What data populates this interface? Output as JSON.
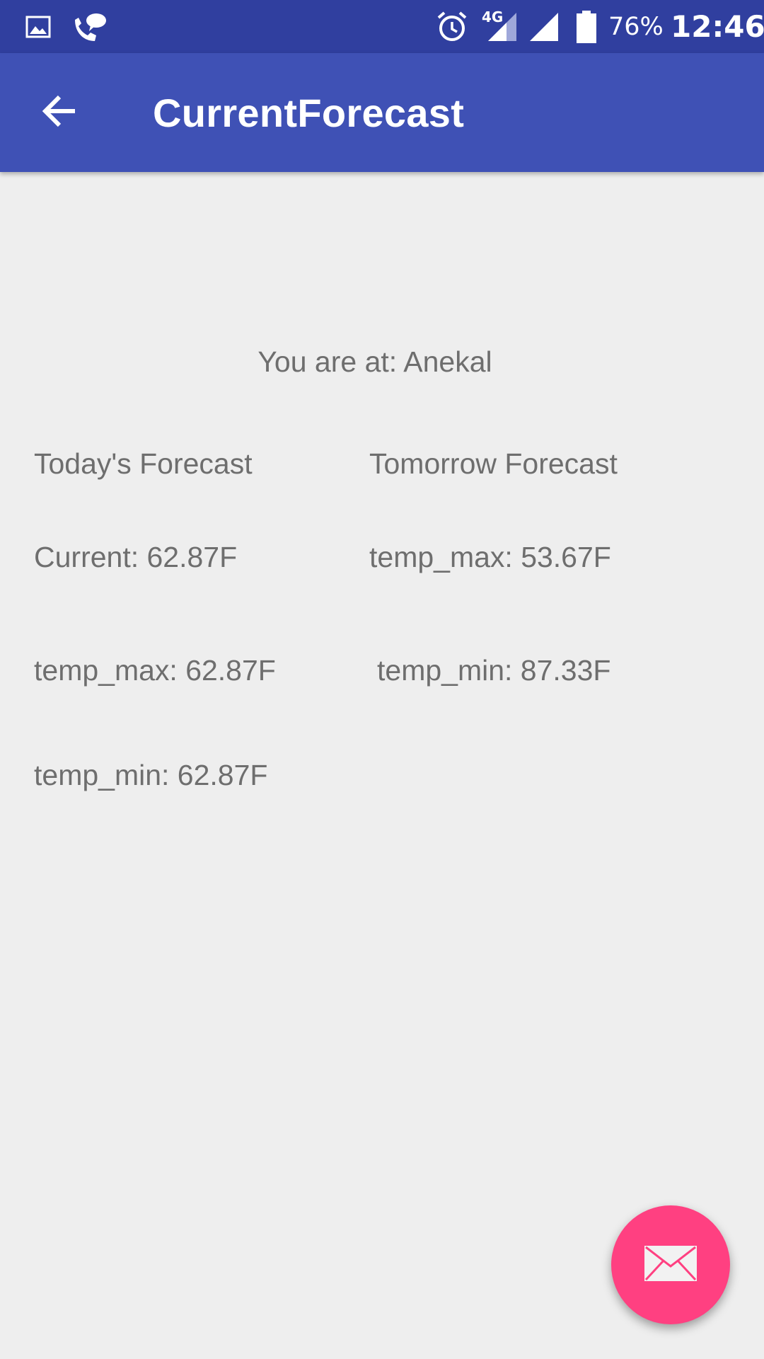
{
  "status_bar": {
    "battery": "76%",
    "time": "12:46",
    "network_label": "4G",
    "icons": [
      "image-icon",
      "call-chat-icon",
      "alarm-icon",
      "signal-4g-icon",
      "signal-icon",
      "battery-icon"
    ]
  },
  "app_bar": {
    "title": "CurrentForecast",
    "back_icon": "arrow-back-icon",
    "color": "#3f51b5"
  },
  "location": {
    "text": "You are at: Anekal"
  },
  "today": {
    "heading": "Today's Forecast",
    "current": "Current: 62.87F",
    "temp_max": "temp_max: 62.87F",
    "temp_min": "temp_min: 62.87F"
  },
  "tomorrow": {
    "heading": "Tomorrow Forecast",
    "temp_max": "temp_max: 53.67F",
    "temp_min": "temp_min: 87.33F"
  },
  "fab": {
    "icon": "mail-icon",
    "color": "#ff4081"
  }
}
